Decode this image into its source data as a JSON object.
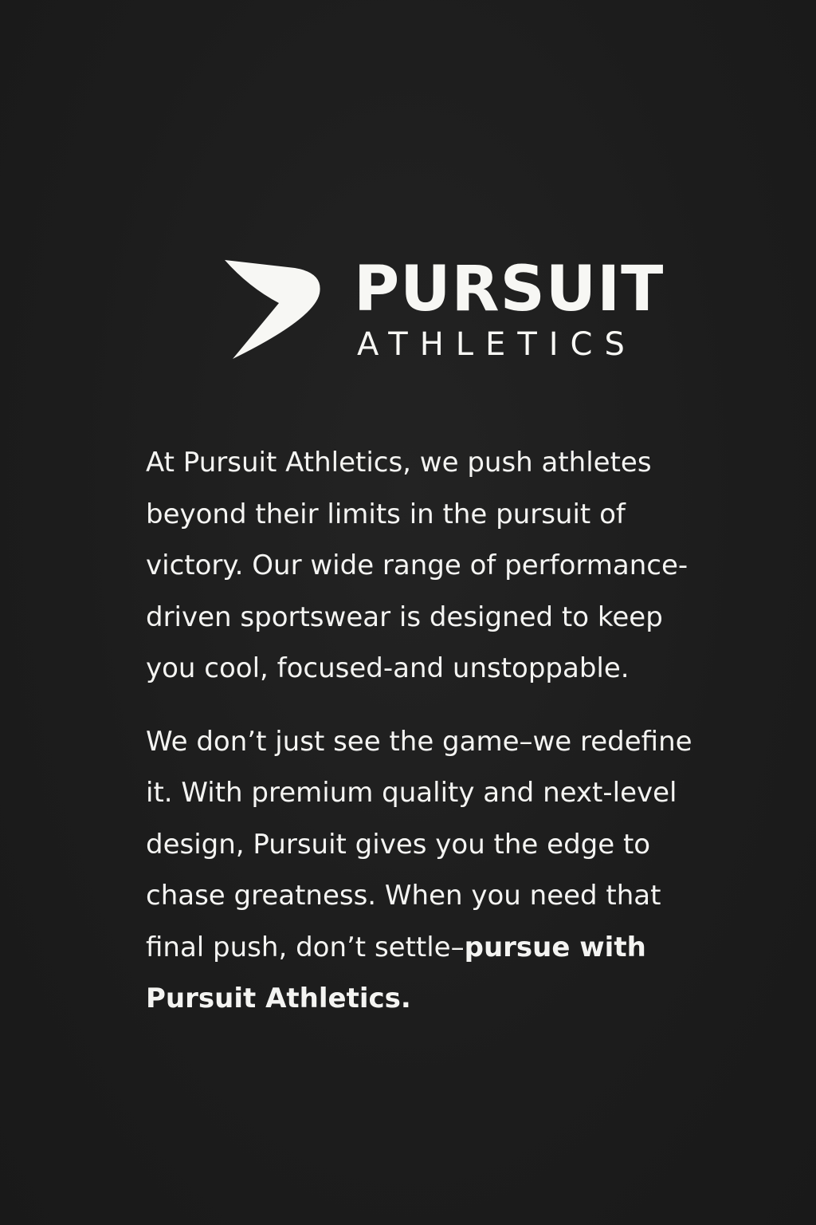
{
  "brand": {
    "logo_icon": "pursuit-swoosh-icon",
    "name": "PURSUIT",
    "sub": "ATHLETICS",
    "color": "#f7f7f4"
  },
  "background_color": "#1e1e1e",
  "copy": {
    "paragraph1": "  At Pursuit Athletics, we push athletes\nbeyond their limits in the pursuit of\nvictory. Our wide range of performance-\ndriven sportswear is designed to keep\nyou cool, focused-and unstoppable.",
    "paragraph2_lead": "We don’t just see the game–we redefine\nit. With premium quality and next-level\ndesign, Pursuit gives you the edge to\nchase greatness. When you need that\nfinal push, don’t settle–",
    "paragraph2_bold": "pursue with\nPursuit Athletics."
  }
}
